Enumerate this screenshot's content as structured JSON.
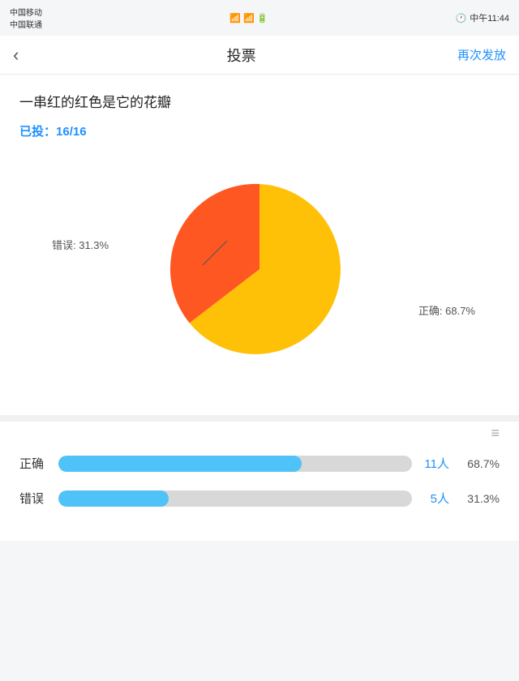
{
  "statusBar": {
    "carrier1": "中国移动",
    "carrier2": "中国联通",
    "time": "中午11:44"
  },
  "navBar": {
    "backIcon": "‹",
    "title": "投票",
    "action": "再次发放"
  },
  "question": {
    "text": "一串红的红色是它的花瓣"
  },
  "voteCount": {
    "label": "已投：",
    "value": "16/16"
  },
  "pieChart": {
    "correctPercent": 68.7,
    "wrongPercent": 31.3,
    "correctLabel": "正确: 68.7%",
    "wrongLabel": "错误: 31.3%",
    "correctColor": "#FFC107",
    "wrongColor": "#FF5722"
  },
  "stats": {
    "listIconLabel": "≡",
    "rows": [
      {
        "label": "正确",
        "fillPercent": 68.7,
        "count": "11人",
        "percent": "68.7%"
      },
      {
        "label": "错误",
        "fillPercent": 31.3,
        "count": "5人",
        "percent": "31.3%"
      }
    ]
  }
}
